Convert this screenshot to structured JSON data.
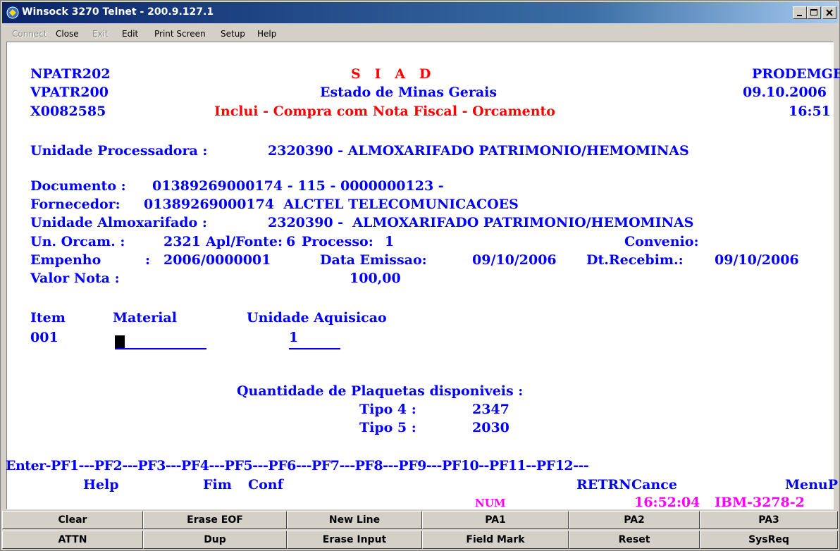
{
  "window": {
    "title": "Winsock 3270 Telnet - 200.9.127.1"
  },
  "menu": {
    "items": [
      "Connect",
      "Close",
      "Exit",
      "Edit",
      "Print Screen",
      "Setup",
      "Help"
    ]
  },
  "screen": {
    "l1": {
      "prog": "NPATR202",
      "title": "S   I   A   D",
      "org": "PRODEMGE"
    },
    "l2": {
      "prog": "VPATR200",
      "title": "Estado de Minas Gerais",
      "date": "09.10.2006"
    },
    "l3": {
      "prog": "X0082585",
      "title": "Inclui - Compra com Nota Fiscal - Orcamento",
      "time": "16:51"
    },
    "unidade_proc": {
      "label": "Unidade Processadora :",
      "value": "2320390 - ALMOXARIFADO PATRIMONIO/HEMOMINAS"
    },
    "documento": {
      "label": "Documento :",
      "value": "01389269000174 - 115 - 0000000123 -"
    },
    "fornecedor": {
      "label": "Fornecedor:",
      "value": "01389269000174  ALCTEL TELECOMUNICACOES"
    },
    "unidade_almox": {
      "label": "Unidade Almoxarifado :",
      "value": "2320390 -  ALMOXARIFADO PATRIMONIO/HEMOMINAS"
    },
    "un_orcam": {
      "label": "Un. Orcam. :",
      "value": "2321",
      "apl_label": "Apl/Fonte:",
      "apl_value": "6",
      "proc_label": "Processo:",
      "proc_value": "1",
      "conv_label": "Convenio:"
    },
    "empenho": {
      "label": "Empenho",
      "sep": ":",
      "value": "2006/0000001",
      "emissao_label": "Data Emissao:",
      "emissao_value": "09/10/2006",
      "receb_label": "Dt.Recebim.:",
      "receb_value": "09/10/2006"
    },
    "valor_nota": {
      "label": "Valor Nota :",
      "value": "100,00"
    },
    "headers": {
      "item": "Item",
      "material": "Material",
      "unidade": "Unidade Aquisicao"
    },
    "row": {
      "item": "001",
      "material": "",
      "unidade": "1"
    },
    "plaquetas": {
      "label": "Quantidade de Plaquetas disponiveis :",
      "t4_label": "Tipo 4 :",
      "t4_value": "2347",
      "t5_label": "Tipo 5 :",
      "t5_value": "2030"
    },
    "pfline": "Enter-PF1---PF2---PF3---PF4---PF5---PF6---PF7---PF8---PF9---PF10--PF11--PF12---",
    "pfkeys": {
      "help": "Help",
      "fim": "Fim",
      "conf": "Conf",
      "retrn": "RETRN",
      "cance": "Cance",
      "menup": "MenuP"
    },
    "status": {
      "num": "NUM",
      "clock": "16:52:04",
      "term": "IBM-3278-2"
    }
  },
  "buttons": {
    "row1": [
      "Clear",
      "Erase EOF",
      "New Line",
      "PA1",
      "PA2",
      "PA3"
    ],
    "row2": [
      "ATTN",
      "Dup",
      "Erase Input",
      "Field Mark",
      "Reset",
      "SysReq"
    ]
  },
  "colors": {
    "field": "#0000ff",
    "title": "#ff0000",
    "status": "#ff00ff",
    "titlebar": "#0a246a"
  }
}
